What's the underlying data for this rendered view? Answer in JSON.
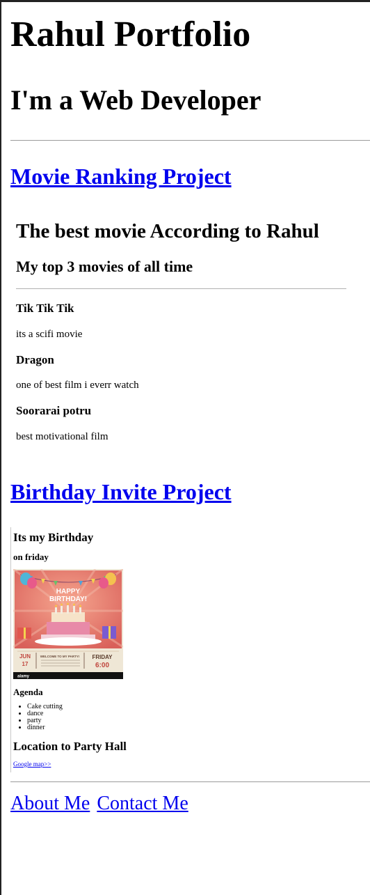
{
  "page": {
    "title": "Rahul Portfolio",
    "subtitle": "I'm a Web Developer"
  },
  "projects": {
    "movie": {
      "link_label": "Movie Ranking Project",
      "heading": "The best movie According to Rahul",
      "subheading": "My top 3 movies of all time",
      "movies": [
        {
          "title": "Tik Tik Tik",
          "description": "its a scifi movie"
        },
        {
          "title": "Dragon",
          "description": "one of best film i everr watch"
        },
        {
          "title": "Soorarai potru",
          "description": "best motivational film"
        }
      ]
    },
    "birthday": {
      "link_label": "Birthday Invite Project",
      "heading": "Its my Birthday",
      "subheading": "on friday",
      "image": {
        "banner": "HAPPY BIRTHDAY!",
        "month": "JUN",
        "day": "17",
        "welcome": "WELCOME TO MY PARTY!",
        "weekday": "FRIDAY",
        "time": "6:00",
        "watermark": "alamy"
      },
      "agenda_heading": "Agenda",
      "agenda": [
        "Cake cutting",
        "dance",
        "party",
        "dinner"
      ],
      "location_heading": "Location to Party Hall",
      "map_link": "Google map>>"
    }
  },
  "nav": {
    "about": "About Me",
    "contact": "Contact Me"
  }
}
